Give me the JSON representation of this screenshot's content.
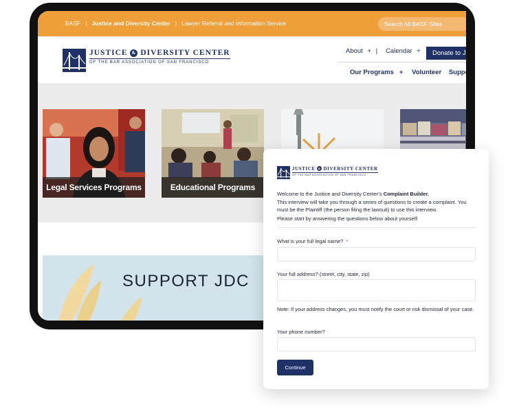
{
  "utility_bar": {
    "links": [
      "BASF",
      "|",
      "Justice and Diversity Center",
      "|",
      "Lawyer Referral and Information Service"
    ],
    "search_placeholder": "Search All BASF Sites"
  },
  "logo": {
    "line1_a": "JUSTICE",
    "amp": "&",
    "line1_b": "DIVERSITY CENTER",
    "line2": "OF THE BAR ASSOCIATION OF SAN FRANCISCO"
  },
  "nav": {
    "about": "About",
    "calendar": "Calendar",
    "plus": "+",
    "sep": "|",
    "donate": "Donate to JDC",
    "programs": "Our Programs",
    "volunteer": "Volunteer",
    "support": "Support Us"
  },
  "cards": [
    {
      "label": "Legal Services Programs"
    },
    {
      "label": "Educational Programs"
    },
    {
      "label": ""
    },
    {
      "label": ""
    }
  ],
  "banner": {
    "text": "SUPPORT JDC"
  },
  "complaint_builder": {
    "intro_prefix": "Welcome to the Justice and Diversity Center's ",
    "intro_bold": "Complaint Builder.",
    "intro_2": "This interview will take you through a series of questions to create a complaint. You must be the Plaintiff (the person filing the lawsuit) to use this interview.",
    "intro_3": "Please start by answering the questions below about yourself:",
    "q_name": "What is your full legal name?",
    "required_mark": "*",
    "q_address": "Your full address? (street, city, state, zip)",
    "address_note": "Note: If your address changes, you must notify the court or risk dismissal of your case.",
    "q_phone": "Your phone number?",
    "continue_label": "Continue"
  },
  "colors": {
    "utility_orange": "#ef9f3a",
    "navy": "#1f3166",
    "gray_band": "#ececec"
  }
}
